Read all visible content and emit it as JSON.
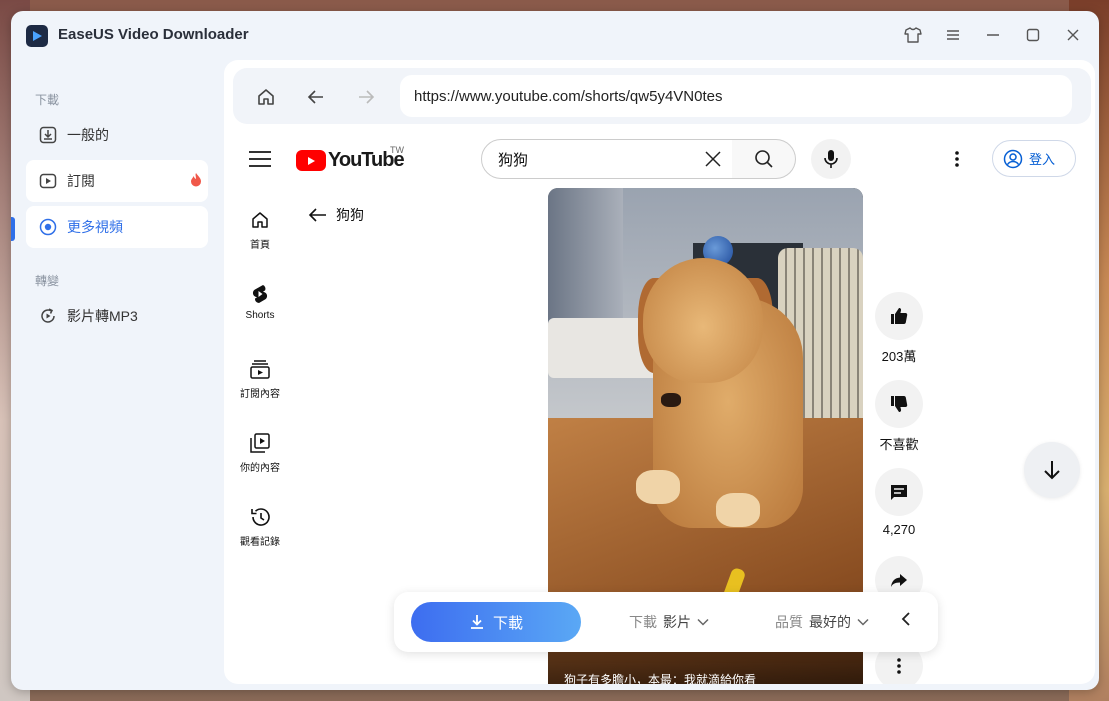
{
  "app": {
    "title": "EaseUS Video Downloader"
  },
  "window_controls": {
    "skin": "shirt-icon",
    "menu": "menu-icon",
    "minimize": "minimize-icon",
    "maximize": "maximize-icon",
    "close": "close-icon"
  },
  "sidebar": {
    "download_section": "下載",
    "convert_section": "轉變",
    "items": [
      {
        "label": "一般的",
        "icon": "download-box-icon"
      },
      {
        "label": "訂閱",
        "icon": "play-box-icon",
        "badge_icon": "flame-icon"
      },
      {
        "label": "更多視頻",
        "icon": "play-circle-icon",
        "active": true
      },
      {
        "label": "影片轉MP3",
        "icon": "convert-icon"
      }
    ]
  },
  "browser": {
    "url": "https://www.youtube.com/shorts/qw5y4VN0tes"
  },
  "youtube": {
    "logo_text": "YouTube",
    "region": "TW",
    "search_value": "狗狗",
    "signin_label": "登入",
    "nav": [
      {
        "label": "首頁",
        "icon": "home-icon"
      },
      {
        "label": "Shorts",
        "icon": "shorts-icon"
      },
      {
        "label": "訂閱內容",
        "icon": "subscriptions-icon"
      },
      {
        "label": "你的內容",
        "icon": "library-icon"
      },
      {
        "label": "觀看記錄",
        "icon": "history-icon"
      }
    ],
    "back_label": "狗狗",
    "video_caption": "狗子有多膽小，本最：我就滴給你看",
    "actions": {
      "likes": "203萬",
      "dislike_label": "不喜歡",
      "comments": "4,270"
    }
  },
  "download_bar": {
    "button_label": "下載",
    "type_label": "下載",
    "type_value": "影片",
    "quality_label": "品質",
    "quality_value": "最好的"
  },
  "colors": {
    "accent": "#2f6fe8",
    "youtube_red": "#ff0000"
  }
}
